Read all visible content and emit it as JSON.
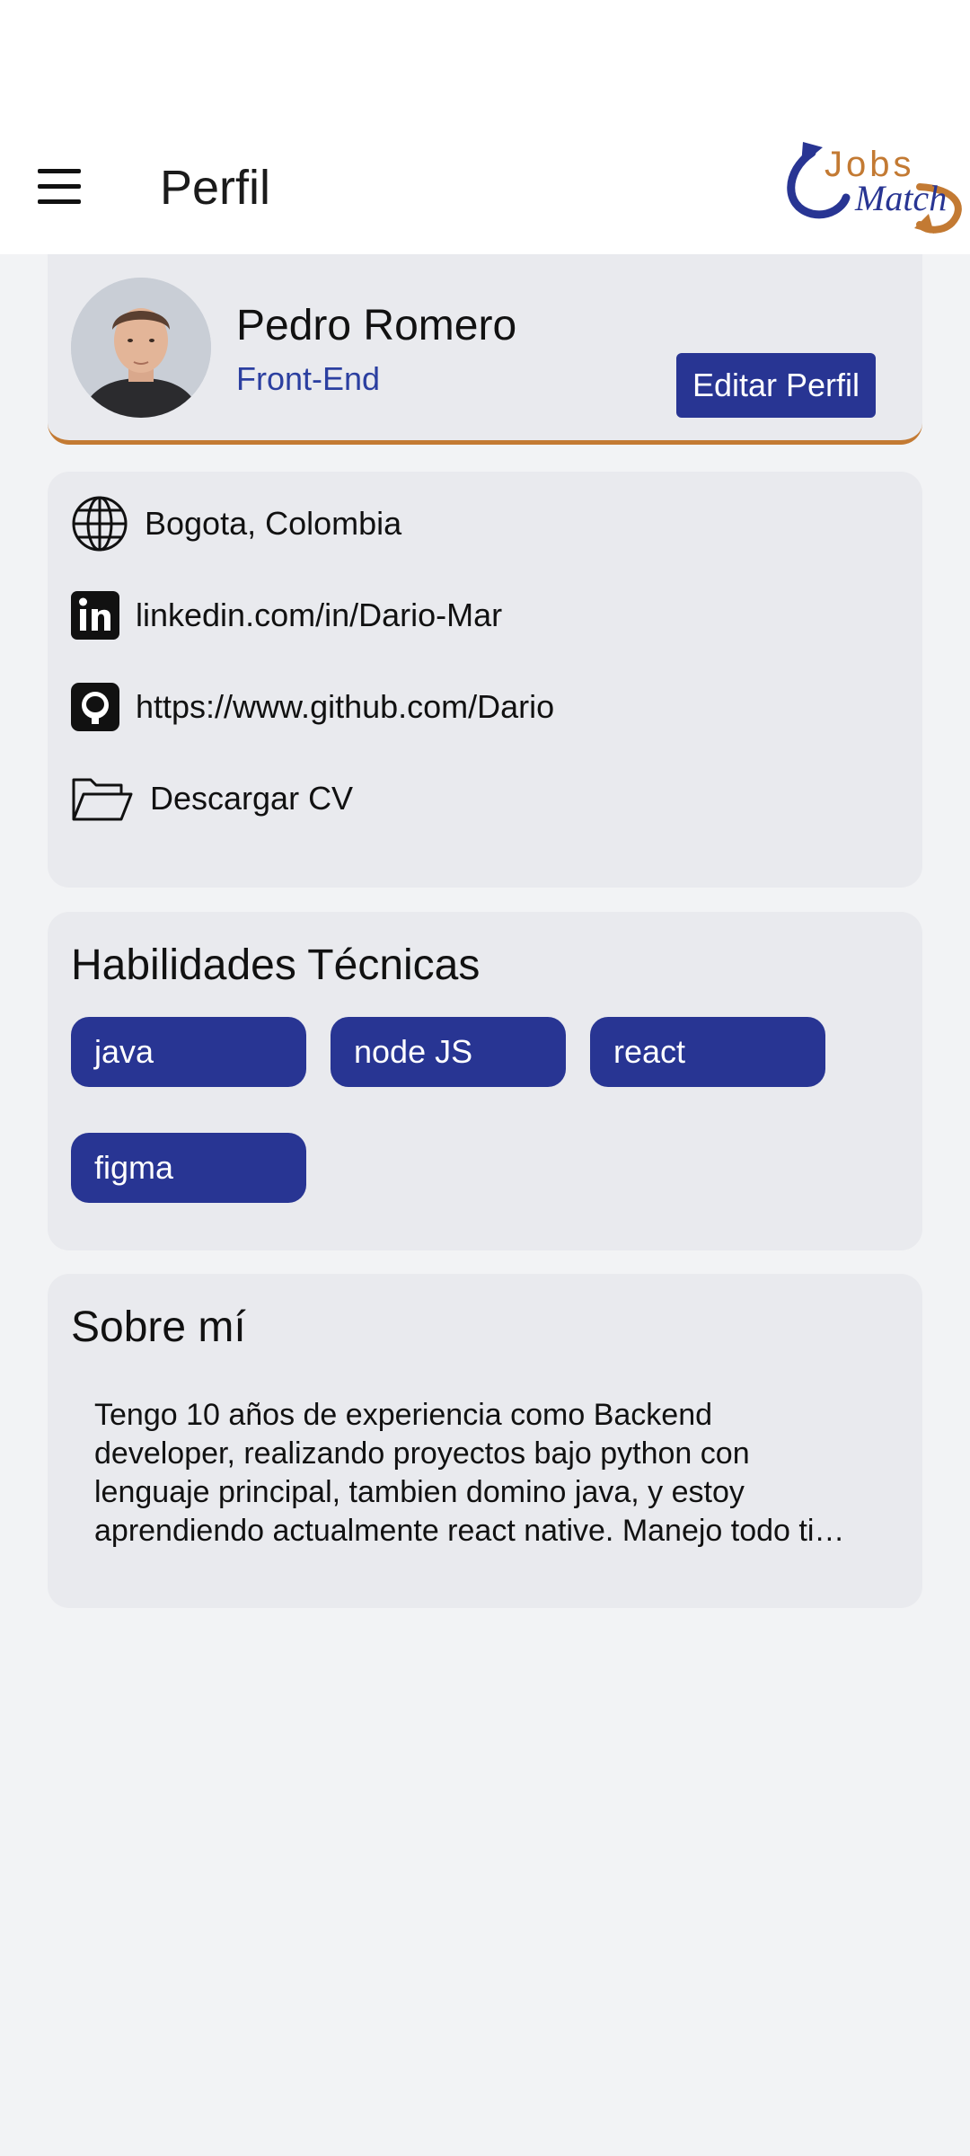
{
  "header": {
    "title": "Perfil",
    "menu_icon": "hamburger-menu-icon",
    "logo": {
      "line1": "Jobs",
      "line2": "Match",
      "colors": {
        "blue": "#283593",
        "orange": "#c37a33"
      }
    }
  },
  "profile": {
    "name": "Pedro Romero",
    "role": "Front-End",
    "edit_label": "Editar Perfil",
    "accent_color": "#c37a33"
  },
  "contact": {
    "items": [
      {
        "icon": "globe-icon",
        "text": "Bogota, Colombia"
      },
      {
        "icon": "linkedin-icon",
        "text": "linkedin.com/in/Dario-Mar"
      },
      {
        "icon": "github-icon",
        "text": "https://www.github.com/Dario"
      },
      {
        "icon": "folder-icon",
        "text": "Descargar CV"
      }
    ]
  },
  "skills": {
    "title": "Habilidades Técnicas",
    "items": [
      "java",
      "node JS",
      "react",
      "figma"
    ],
    "chip_color": "#283593"
  },
  "about": {
    "title": "Sobre mí",
    "text": "Tengo 10 años de experiencia como Backend developer, realizando proyectos bajo python con lenguaje principal, tambien domino java, y estoy aprendiendo actualmente react native. Manejo todo tipo de herramientas"
  }
}
